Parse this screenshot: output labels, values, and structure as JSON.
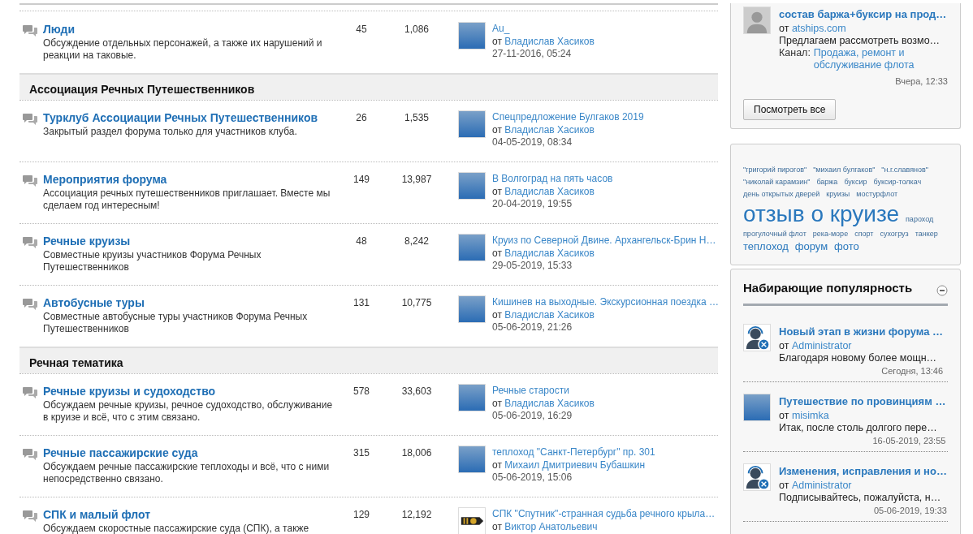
{
  "groups": [
    {
      "forums": [
        {
          "title": "Люди",
          "description": "Обсуждение отдельных персонажей, а также их нарушений и реакции на таковые.",
          "topics": "45",
          "posts": "1,086",
          "last": {
            "kind": "photo",
            "title": "Au_",
            "by": "от",
            "author": "Владислав Хасиков",
            "date": "27-11-2016, 05:24"
          }
        }
      ]
    },
    {
      "title": "Ассоциация Речных Путешественников",
      "forums": [
        {
          "title": "Турклуб Ассоциации Речных Путешественников",
          "description": "Закрытый раздел форума только для участников клуба.",
          "topics": "26",
          "posts": "1,535",
          "last": {
            "kind": "photo",
            "title": "Спецпредложение Булгаков 2019",
            "by": "от",
            "author": "Владислав Хасиков",
            "date": "04-05-2019, 08:34"
          }
        },
        {
          "title": "Мероприятия форума",
          "description": "Ассоциация речных путешественников приглашает. Вместе мы сделаем год интересным!",
          "topics": "149",
          "posts": "13,987",
          "last": {
            "kind": "photo",
            "title": "В Волгоград на пять часов",
            "by": "от",
            "author": "Владислав Хасиков",
            "date": "20-04-2019, 19:55"
          }
        },
        {
          "title": "Речные круизы",
          "description": "Совместные круизы участников Форума Речных Путешественников",
          "topics": "48",
          "posts": "8,242",
          "last": {
            "kind": "photo",
            "title": "Круиз по Северной Двине. Архангельск-Брин Н…",
            "by": "от",
            "author": "Владислав Хасиков",
            "date": "29-05-2019, 15:33"
          }
        },
        {
          "title": "Автобусные туры",
          "description": "Совместные автобусные туры участников Форума Речных Путешественников",
          "topics": "131",
          "posts": "10,775",
          "last": {
            "kind": "photo",
            "title": "Кишинев на выходные. Экскурсионная поездка …",
            "by": "от",
            "author": "Владислав Хасиков",
            "date": "05-06-2019, 21:26"
          }
        }
      ]
    },
    {
      "title": "Речная тематика",
      "forums": [
        {
          "title": "Речные круизы и судоходство",
          "description": "Обсуждаем речные круизы, речное судоходство, обслуживание в круизе и всё, что с этим связано.",
          "topics": "578",
          "posts": "33,603",
          "last": {
            "kind": "photo",
            "title": "Речные старости",
            "by": "от",
            "author": "Владислав Хасиков",
            "date": "05-06-2019, 16:29"
          }
        },
        {
          "title": "Речные пассажирские суда",
          "description": "Обсуждаем речные пассажирские теплоходы и всё, что с ними непосредственно связано.",
          "topics": "315",
          "posts": "18,006",
          "last": {
            "kind": "photo",
            "title": "теплоход \"Санкт-Петербург\" пр. 301",
            "by": "от",
            "author": "Михаил Дмитриевич Бубашкин",
            "date": "05-06-2019, 15:06"
          }
        },
        {
          "title": "СПК и малый флот",
          "description": "Обсуждаем скоростные пассажирские суда (СПК), а также",
          "topics": "129",
          "posts": "12,192",
          "last": {
            "kind": "epaulette",
            "title": "СПК \"Спутник\"-странная судьба речного крыла…",
            "by": "от",
            "author": "Виктор Анатольевич"
          }
        }
      ]
    }
  ],
  "classifieds": {
    "item": {
      "title": "состав баржа+буксир на прод…",
      "by": "от",
      "author": "atships.com",
      "excerpt": "Предлагаем рассмотреть возмо…",
      "channel_label": "Канал:",
      "channel": "Продажа, ремонт и обслуживание флота",
      "time": "Вчера, 12:33"
    },
    "button": "Посмотреть все"
  },
  "tags": [
    {
      "label": "\"григорий пирогов\"",
      "kind": "small"
    },
    {
      "label": "\"михаил булгаков\"",
      "kind": "small"
    },
    {
      "label": "\"н.г.славянов\"",
      "kind": "small"
    },
    {
      "label": "\"николай карамзин\"",
      "kind": "small"
    },
    {
      "label": "баржа",
      "kind": "small"
    },
    {
      "label": "буксир",
      "kind": "small"
    },
    {
      "label": "буксир-толкач",
      "kind": "small"
    },
    {
      "label": "день открытых дверей",
      "kind": "small"
    },
    {
      "label": "круизы",
      "kind": "small"
    },
    {
      "label": "мостурфлот",
      "kind": "small"
    },
    {
      "label": "отзыв о круизе",
      "kind": "large"
    },
    {
      "label": "пароход",
      "kind": "small"
    },
    {
      "label": "прогулочный флот",
      "kind": "small"
    },
    {
      "label": "река-море",
      "kind": "small"
    },
    {
      "label": "спорт",
      "kind": "small"
    },
    {
      "label": "сухогруз",
      "kind": "small"
    },
    {
      "label": "танкер",
      "kind": "small"
    },
    {
      "label": "теплоход",
      "kind": "medium"
    },
    {
      "label": "форум",
      "kind": "medium"
    },
    {
      "label": "фото",
      "kind": "medium"
    }
  ],
  "trending": {
    "title": "Набирающие популярность",
    "expanded": true,
    "items": [
      {
        "kind": "admin",
        "title": "Новый этап в жизни форума …",
        "by": "от",
        "author": "Administrator",
        "excerpt": "Благодаря новому более мощн…",
        "time": "Сегодня, 13:46"
      },
      {
        "kind": "photo",
        "title": "Путешествие по провинциям …",
        "by": "от",
        "author": "misimka",
        "excerpt": "Итак, после столь долгого пере…",
        "time": "16-05-2019, 23:55"
      },
      {
        "kind": "admin",
        "title": "Изменения, исправления и но…",
        "by": "от",
        "author": "Administrator",
        "excerpt": "Подписывайтесь, пожалуйста, н…",
        "time": "05-06-2019, 19:33"
      }
    ]
  }
}
